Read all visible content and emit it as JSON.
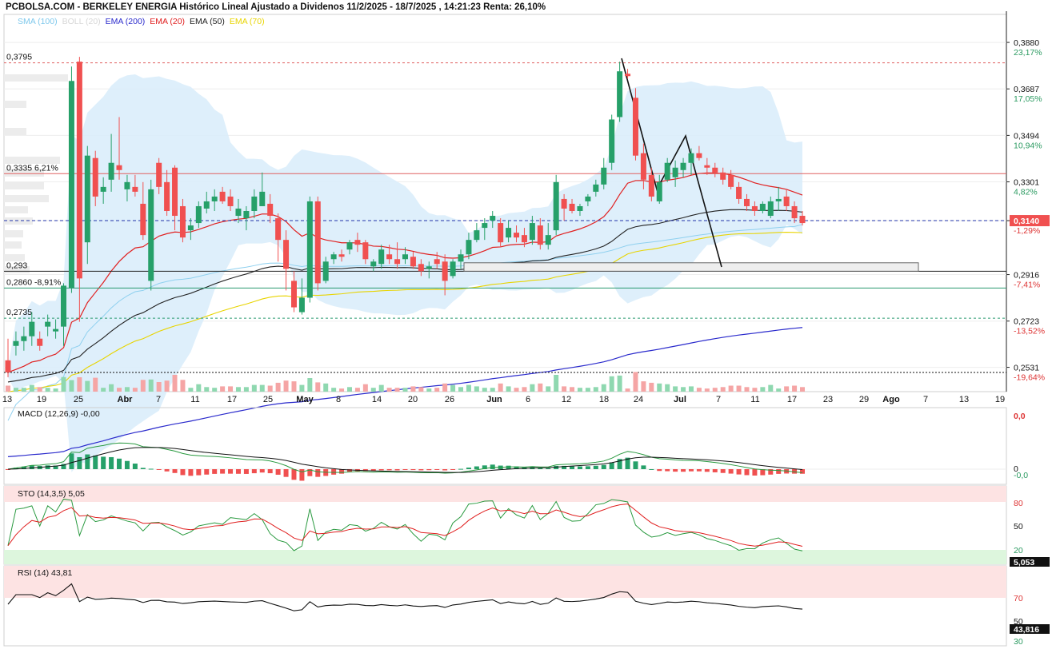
{
  "header": {
    "title": "PCBOLSA.COM - BERKELEY ENERGIA Histórico Lineal Ajustado a Dividenos 11/2/2025 - 18/7/2025 , 14:21:23 Renta: 26,10%"
  },
  "legend": [
    {
      "label": "SMA (100)",
      "color": "#7ec8ec"
    },
    {
      "label": "BOLL (20)",
      "color": "#d6d6d6"
    },
    {
      "label": "EMA (200)",
      "color": "#2a2acc"
    },
    {
      "label": "EMA (20)",
      "color": "#e02020"
    },
    {
      "label": "EMA (50)",
      "color": "#222222"
    },
    {
      "label": "EMA (70)",
      "color": "#e8d400"
    }
  ],
  "colors": {
    "up": "#26a069",
    "down": "#f05050",
    "bollinger": "#d8ecfa"
  },
  "chart_data": {
    "type": "candlestick",
    "x_tick_labels": [
      "13",
      "19",
      "25",
      "Abr",
      "7",
      "11",
      "17",
      "25",
      "May",
      "8",
      "14",
      "20",
      "26",
      "Jun",
      "6",
      "12",
      "18",
      "24",
      "Jul",
      "7",
      "11",
      "17",
      "23",
      "29",
      "Ago",
      "7",
      "13",
      "19"
    ],
    "y_axis": {
      "ticks": [
        {
          "value": "0,3880",
          "pct": "23,17%"
        },
        {
          "value": "0,3687",
          "pct": "17,05%"
        },
        {
          "value": "0,3494",
          "pct": "10,94%"
        },
        {
          "value": "0,3301",
          "pct": "4,82%"
        },
        {
          "value": "0,3140",
          "pct": "-1,29%"
        },
        {
          "value": "0,2916",
          "pct": "-7,41%"
        },
        {
          "value": "0,2723",
          "pct": "-13,52%"
        },
        {
          "value": "0,2531",
          "pct": "-19,64%"
        }
      ],
      "range": [
        0.243,
        0.393
      ]
    },
    "price_levels": [
      {
        "label": "0,3795",
        "value": 0.3795,
        "style": "dashed",
        "color": "#e06060"
      },
      {
        "label": "0,3335  6,21%",
        "value": 0.3335,
        "style": "solid",
        "color": "#e06060"
      },
      {
        "label": "0,293",
        "value": 0.293,
        "style": "solid",
        "color": "#222222"
      },
      {
        "label": "0,2860  -8,91%",
        "value": 0.286,
        "style": "solid",
        "color": "#2a9a70"
      },
      {
        "label": "0,2735",
        "value": 0.2735,
        "style": "dashed",
        "color": "#2a9a70"
      }
    ],
    "current_price": {
      "label": "0,3140",
      "value": 0.314
    },
    "candles": [
      [
        0.256,
        0.265,
        0.249,
        0.251
      ],
      [
        0.262,
        0.268,
        0.258,
        0.264
      ],
      [
        0.264,
        0.27,
        0.26,
        0.266
      ],
      [
        0.266,
        0.276,
        0.262,
        0.272
      ],
      [
        0.265,
        0.268,
        0.26,
        0.262
      ],
      [
        0.27,
        0.275,
        0.266,
        0.272
      ],
      [
        0.268,
        0.273,
        0.265,
        0.269
      ],
      [
        0.27,
        0.288,
        0.262,
        0.287
      ],
      [
        0.286,
        0.378,
        0.284,
        0.372
      ],
      [
        0.38,
        0.382,
        0.272,
        0.29
      ],
      [
        0.305,
        0.345,
        0.296,
        0.341
      ],
      [
        0.34,
        0.343,
        0.32,
        0.324
      ],
      [
        0.326,
        0.332,
        0.321,
        0.328
      ],
      [
        0.331,
        0.35,
        0.326,
        0.338
      ],
      [
        0.337,
        0.357,
        0.331,
        0.335
      ],
      [
        0.327,
        0.333,
        0.322,
        0.33
      ],
      [
        0.328,
        0.333,
        0.324,
        0.326
      ],
      [
        0.321,
        0.33,
        0.306,
        0.308
      ],
      [
        0.289,
        0.331,
        0.285,
        0.327
      ],
      [
        0.338,
        0.34,
        0.325,
        0.328
      ],
      [
        0.33,
        0.335,
        0.316,
        0.318
      ],
      [
        0.336,
        0.337,
        0.31,
        0.316
      ],
      [
        0.32,
        0.323,
        0.305,
        0.307
      ],
      [
        0.31,
        0.315,
        0.306,
        0.312
      ],
      [
        0.313,
        0.322,
        0.311,
        0.32
      ],
      [
        0.319,
        0.326,
        0.317,
        0.322
      ],
      [
        0.322,
        0.327,
        0.318,
        0.324
      ],
      [
        0.326,
        0.328,
        0.321,
        0.322
      ],
      [
        0.324,
        0.327,
        0.318,
        0.32
      ],
      [
        0.316,
        0.323,
        0.313,
        0.319
      ],
      [
        0.315,
        0.32,
        0.31,
        0.318
      ],
      [
        0.318,
        0.327,
        0.315,
        0.324
      ],
      [
        0.32,
        0.334,
        0.32,
        0.326
      ],
      [
        0.321,
        0.325,
        0.313,
        0.316
      ],
      [
        0.315,
        0.317,
        0.297,
        0.306
      ],
      [
        0.306,
        0.31,
        0.285,
        0.294
      ],
      [
        0.289,
        0.293,
        0.276,
        0.278
      ],
      [
        0.276,
        0.29,
        0.275,
        0.282
      ],
      [
        0.282,
        0.324,
        0.28,
        0.322
      ],
      [
        0.322,
        0.324,
        0.285,
        0.288
      ],
      [
        0.289,
        0.299,
        0.288,
        0.297
      ],
      [
        0.298,
        0.301,
        0.296,
        0.3
      ],
      [
        0.3,
        0.302,
        0.297,
        0.299
      ],
      [
        0.302,
        0.306,
        0.3,
        0.305
      ],
      [
        0.306,
        0.309,
        0.301,
        0.304
      ],
      [
        0.305,
        0.306,
        0.296,
        0.298
      ],
      [
        0.295,
        0.298,
        0.293,
        0.297
      ],
      [
        0.296,
        0.304,
        0.294,
        0.302
      ],
      [
        0.3,
        0.304,
        0.296,
        0.298
      ],
      [
        0.298,
        0.305,
        0.294,
        0.296
      ],
      [
        0.298,
        0.303,
        0.296,
        0.3
      ],
      [
        0.299,
        0.301,
        0.294,
        0.295
      ],
      [
        0.296,
        0.298,
        0.291,
        0.293
      ],
      [
        0.294,
        0.297,
        0.29,
        0.295
      ],
      [
        0.298,
        0.301,
        0.294,
        0.296
      ],
      [
        0.297,
        0.3,
        0.283,
        0.289
      ],
      [
        0.291,
        0.298,
        0.29,
        0.297
      ],
      [
        0.297,
        0.302,
        0.294,
        0.3
      ],
      [
        0.3,
        0.309,
        0.298,
        0.306
      ],
      [
        0.306,
        0.313,
        0.305,
        0.31
      ],
      [
        0.311,
        0.315,
        0.306,
        0.313
      ],
      [
        0.314,
        0.318,
        0.311,
        0.316
      ],
      [
        0.313,
        0.315,
        0.303,
        0.305
      ],
      [
        0.307,
        0.314,
        0.305,
        0.311
      ],
      [
        0.309,
        0.312,
        0.305,
        0.307
      ],
      [
        0.308,
        0.311,
        0.303,
        0.305
      ],
      [
        0.306,
        0.316,
        0.304,
        0.313
      ],
      [
        0.312,
        0.315,
        0.302,
        0.304
      ],
      [
        0.304,
        0.313,
        0.302,
        0.308
      ],
      [
        0.31,
        0.333,
        0.308,
        0.33
      ],
      [
        0.323,
        0.325,
        0.314,
        0.319
      ],
      [
        0.321,
        0.323,
        0.317,
        0.318
      ],
      [
        0.318,
        0.321,
        0.316,
        0.32
      ],
      [
        0.322,
        0.325,
        0.32,
        0.324
      ],
      [
        0.326,
        0.331,
        0.324,
        0.329
      ],
      [
        0.329,
        0.34,
        0.327,
        0.336
      ],
      [
        0.338,
        0.358,
        0.335,
        0.356
      ],
      [
        0.357,
        0.38,
        0.355,
        0.376
      ],
      [
        0.375,
        0.377,
        0.373,
        0.374
      ],
      [
        0.365,
        0.369,
        0.339,
        0.341
      ],
      [
        0.342,
        0.346,
        0.327,
        0.331
      ],
      [
        0.333,
        0.336,
        0.322,
        0.324
      ],
      [
        0.322,
        0.333,
        0.321,
        0.33
      ],
      [
        0.331,
        0.34,
        0.33,
        0.338
      ],
      [
        0.332,
        0.339,
        0.328,
        0.336
      ],
      [
        0.335,
        0.34,
        0.332,
        0.338
      ],
      [
        0.338,
        0.344,
        0.333,
        0.342
      ],
      [
        0.342,
        0.345,
        0.339,
        0.34
      ],
      [
        0.337,
        0.34,
        0.333,
        0.336
      ],
      [
        0.336,
        0.338,
        0.332,
        0.334
      ],
      [
        0.334,
        0.336,
        0.329,
        0.331
      ],
      [
        0.333,
        0.335,
        0.327,
        0.328
      ],
      [
        0.328,
        0.33,
        0.321,
        0.323
      ],
      [
        0.323,
        0.325,
        0.318,
        0.32
      ],
      [
        0.32,
        0.322,
        0.316,
        0.318
      ],
      [
        0.318,
        0.322,
        0.317,
        0.321
      ],
      [
        0.316,
        0.324,
        0.315,
        0.322
      ],
      [
        0.322,
        0.328,
        0.318,
        0.323
      ],
      [
        0.324,
        0.327,
        0.318,
        0.32
      ],
      [
        0.32,
        0.322,
        0.313,
        0.315
      ],
      [
        0.316,
        0.318,
        0.312,
        0.313
      ]
    ],
    "macd": {
      "label": "MACD (12,26,9)",
      "value": "-0,00",
      "axis_ticks": [
        "0,0",
        "0",
        "-0,0"
      ]
    },
    "stochastic": {
      "label": "STO (14,3,5)",
      "value": "5,05",
      "axis_ticks": [
        "80",
        "50",
        "20"
      ],
      "last": "5,053"
    },
    "rsi": {
      "label": "RSI (14)",
      "value": "43,81",
      "axis_ticks": [
        "70",
        "50",
        "30"
      ],
      "last": "43,816"
    }
  }
}
